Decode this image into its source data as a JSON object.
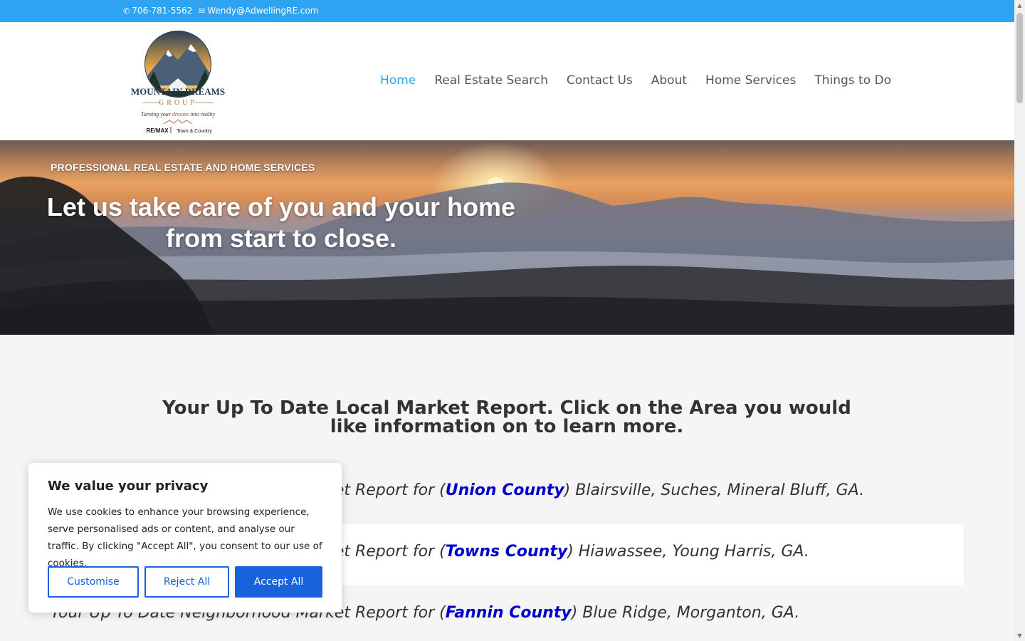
{
  "topbar": {
    "phone": "706-781-5562",
    "email": "Wendy@AdwellingRE.com",
    "phone_icon": "phone-icon",
    "email_icon": "envelope-icon",
    "bg_color": "#2ea3f2"
  },
  "logo": {
    "name_line1": "MOUNTAIN DREAMS",
    "name_line2": "GROUP",
    "tagline_pre": "Turning your ",
    "tagline_em": "dreams",
    "tagline_post": " into reality",
    "broker_brand": "RE/MAX",
    "broker_office": "Town & Country"
  },
  "nav": {
    "items": [
      {
        "label": "Home",
        "active": true
      },
      {
        "label": "Real Estate Search"
      },
      {
        "label": "Contact Us"
      },
      {
        "label": "About"
      },
      {
        "label": "Home Services"
      },
      {
        "label": "Things to Do"
      }
    ],
    "active_color": "#2ea3f2"
  },
  "hero": {
    "eyebrow": "PROFESSIONAL REAL ESTATE AND HOME SERVICES",
    "title": "Let us take care of you and your home from start to close."
  },
  "main": {
    "heading": "Your Up To Date Local Market Report.  Click on the Area you would like information on to learn more.",
    "reports": [
      {
        "prefix": "Your Up To Date Neighborhood Market Report for (",
        "county": "Union County",
        "suffix": ") Blairsville, Suches, Mineral Bluff, GA."
      },
      {
        "prefix": "Your Up To Date Neighborhood Market Report for (",
        "county": "Towns County",
        "suffix": ") Hiawassee, Young Harris, GA."
      },
      {
        "prefix": "Your Up To Date Neighborhood Market Report for (",
        "county": "Fannin County",
        "suffix": ") Blue Ridge, Morganton, GA."
      }
    ],
    "link_color": "#0000cc"
  },
  "cookie": {
    "title": "We value your privacy",
    "body": "We use cookies to enhance your browsing experience, serve personalised ads or content, and analyse our traffic. By clicking \"Accept All\", you consent to our use of cookies.",
    "customise_label": "Customise",
    "reject_label": "Reject All",
    "accept_label": "Accept All",
    "accent_color": "#1863dc"
  }
}
